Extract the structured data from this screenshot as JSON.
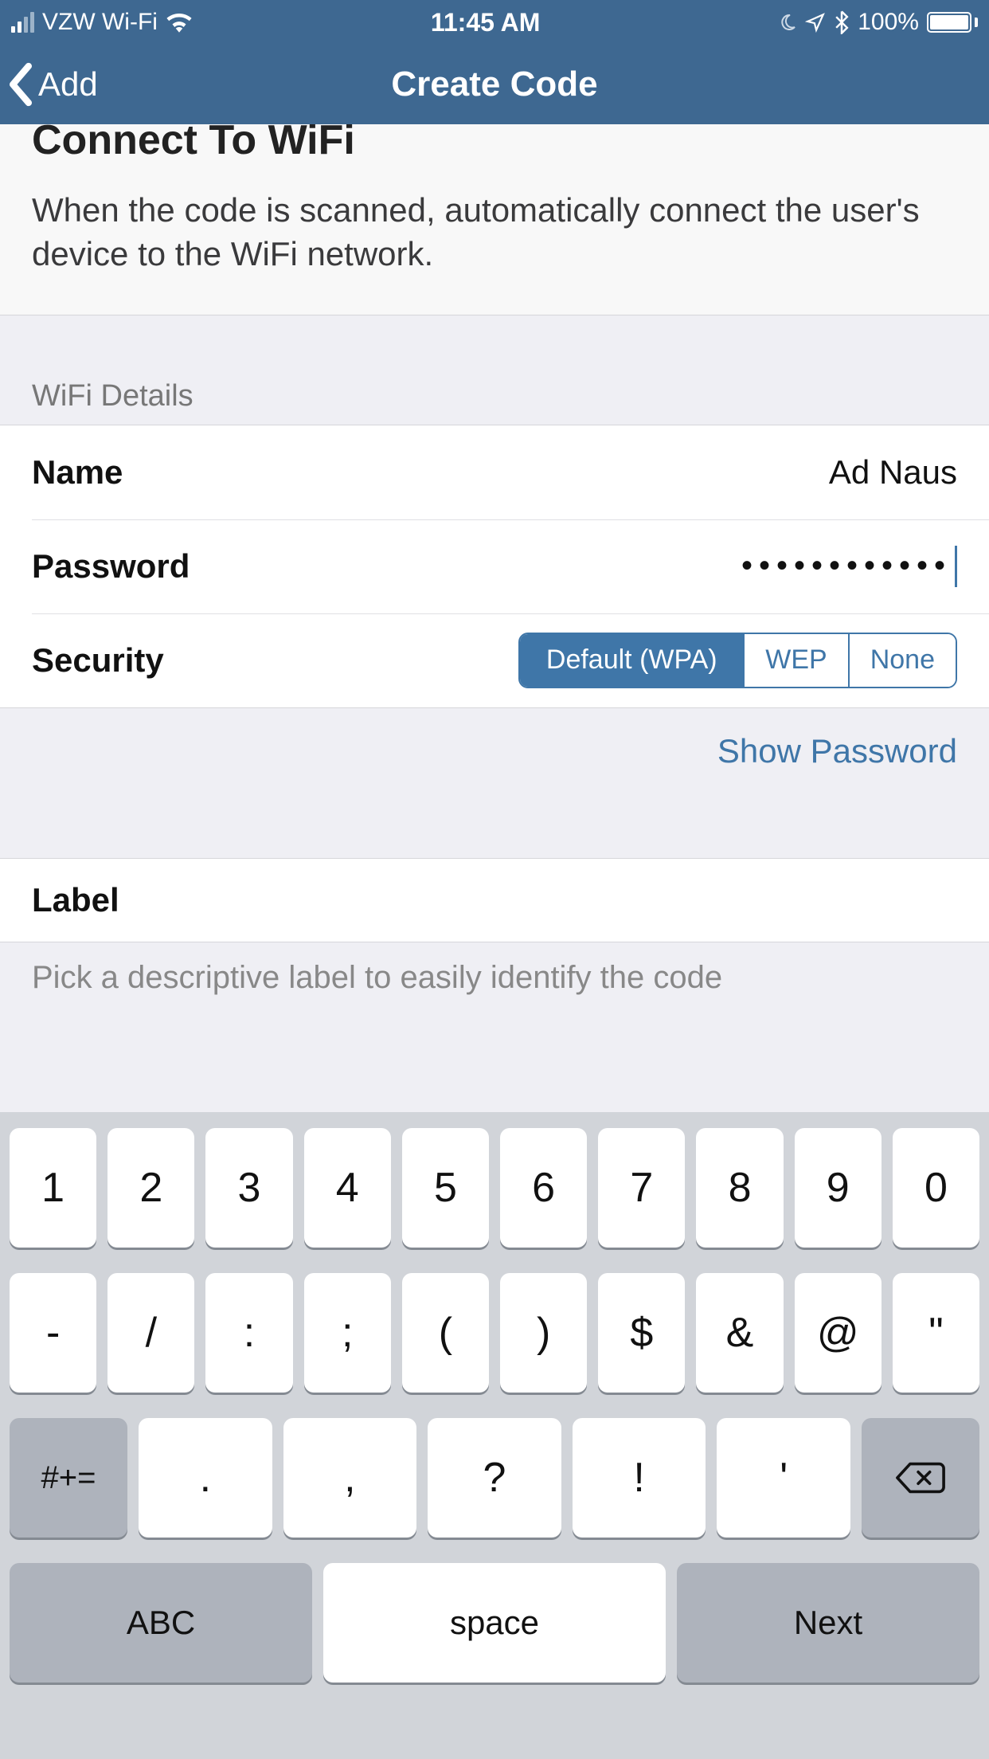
{
  "status_bar": {
    "carrier": "VZW Wi-Fi",
    "time": "11:45 AM",
    "battery_pct": "100%"
  },
  "nav": {
    "back_label": "Add",
    "title": "Create Code"
  },
  "intro": {
    "title": "Connect To WiFi",
    "subtitle": "When the code is scanned, automatically connect the user's device to the WiFi network."
  },
  "wifi_section": {
    "header": "WiFi Details",
    "name_label": "Name",
    "name_value": "Ad Naus",
    "password_label": "Password",
    "password_mask": "••••••••••••",
    "security_label": "Security",
    "security_options": {
      "default": "Default (WPA)",
      "wep": "WEP",
      "none": "None"
    },
    "security_selected": "default",
    "show_password": "Show Password"
  },
  "label_section": {
    "title": "Label",
    "description": "Pick a descriptive label to easily identify the code"
  },
  "keyboard": {
    "row1": [
      "1",
      "2",
      "3",
      "4",
      "5",
      "6",
      "7",
      "8",
      "9",
      "0"
    ],
    "row2": [
      "-",
      "/",
      ":",
      ";",
      "(",
      ")",
      "$",
      "&",
      "@",
      "\""
    ],
    "row3_more": "#+=",
    "row3": [
      ".",
      ",",
      "?",
      "!",
      "'"
    ],
    "abc": "ABC",
    "space": "space",
    "next": "Next"
  }
}
